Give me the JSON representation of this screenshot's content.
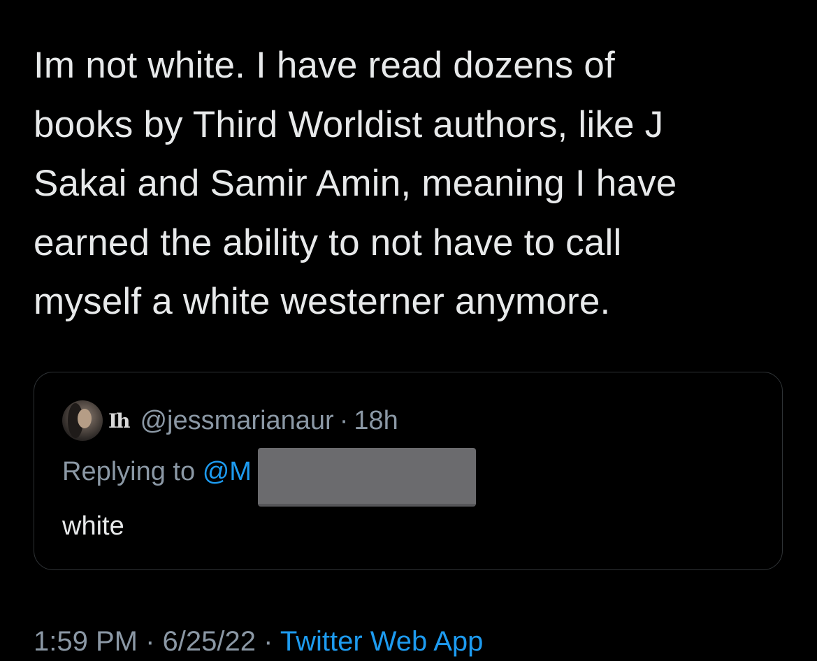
{
  "tweet": {
    "lines": [
      "Im not white. I have read dozens of",
      "books by Third Worldist authors, like J",
      "Sakai and Samir Amin, meaning I have",
      "earned the ability to not have to call",
      "myself a white westerner anymore."
    ]
  },
  "quoted_tweet": {
    "avatar_icon": "profile-photo",
    "display_name_badge": "ᴴh",
    "handle": "@jessmarianaur",
    "separator": "·",
    "time": "18h",
    "replying_prefix": "Replying to",
    "replying_mention": "@M",
    "text": "white"
  },
  "meta": {
    "time": "1:59 PM",
    "separator1": "·",
    "date": "6/25/22",
    "separator2": "·",
    "source": "Twitter Web App"
  },
  "colors": {
    "background": "#000000",
    "text": "#e7e9ea",
    "secondary": "#8b98a5",
    "accent": "#1d9bf0",
    "border": "#2f3336"
  }
}
